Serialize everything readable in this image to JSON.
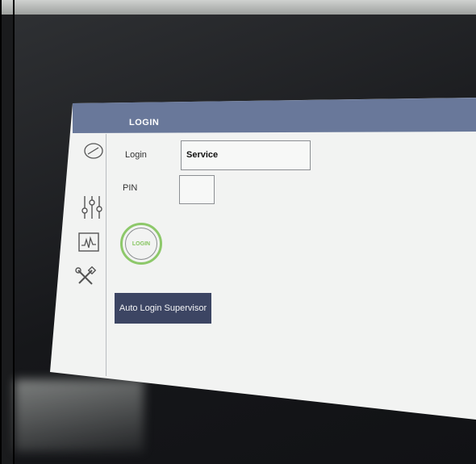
{
  "header": {
    "title": "LOGIN"
  },
  "sidebar": {
    "icons": [
      "gauge-icon",
      "sliders-icon",
      "monitor-chart-icon",
      "tools-icon"
    ]
  },
  "form": {
    "login_label": "Login",
    "login_value": "Service",
    "pin_label": "PIN",
    "pin_value": "",
    "login_button": "LOGIN",
    "auto_login_button": "Auto Login Supervisor"
  },
  "colors": {
    "header": "#69789a",
    "accent": "#8dc86a",
    "button": "#3c4563",
    "screen": "#f2f3f2"
  }
}
